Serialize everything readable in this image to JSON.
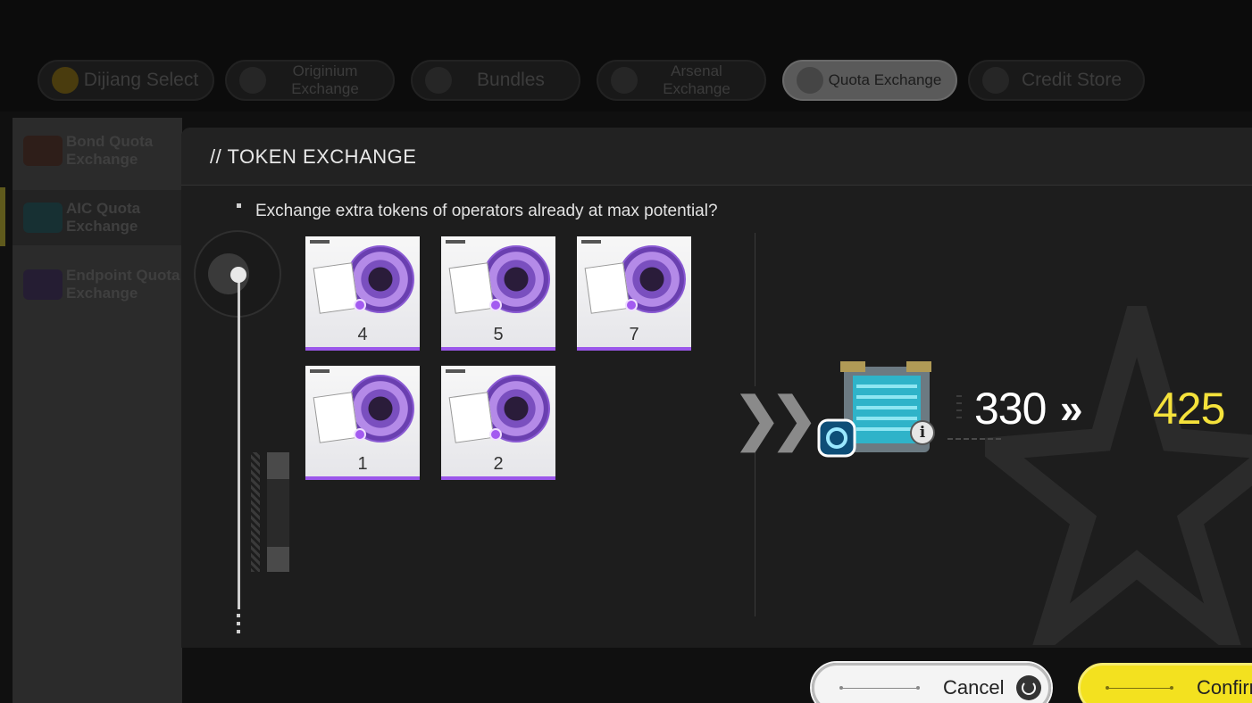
{
  "nav": {
    "tabs": [
      {
        "label": "Originium Exchange"
      },
      {
        "label": "Bundles"
      },
      {
        "label": "Arsenal Exchange"
      },
      {
        "label": "Quota Exchange"
      },
      {
        "label": "Credit Store"
      }
    ],
    "partial_tab_label": "Dijiang Select"
  },
  "categories": [
    {
      "label": "Bond Quota Exchange"
    },
    {
      "label": "AIC Quota Exchange"
    },
    {
      "label": "Endpoint Quota Exchange"
    }
  ],
  "modal": {
    "title": "// TOKEN EXCHANGE",
    "question": "Exchange extra tokens of operators already at max potential?",
    "tokens": [
      {
        "count": "4",
        "color": "#c9302c"
      },
      {
        "count": "5",
        "color": "#1f4e8c"
      },
      {
        "count": "7",
        "color": "#c9ced6"
      },
      {
        "count": "1",
        "color": "#4f6b4a"
      },
      {
        "count": "2",
        "color": "#dcdcd0"
      }
    ],
    "result": {
      "before": "330",
      "arrow": "»",
      "after": "425",
      "before_color": "#ffffff",
      "after_color": "#f5e23b"
    }
  },
  "footer": {
    "cancel_label": "Cancel",
    "confirm_label": "Confirm"
  }
}
